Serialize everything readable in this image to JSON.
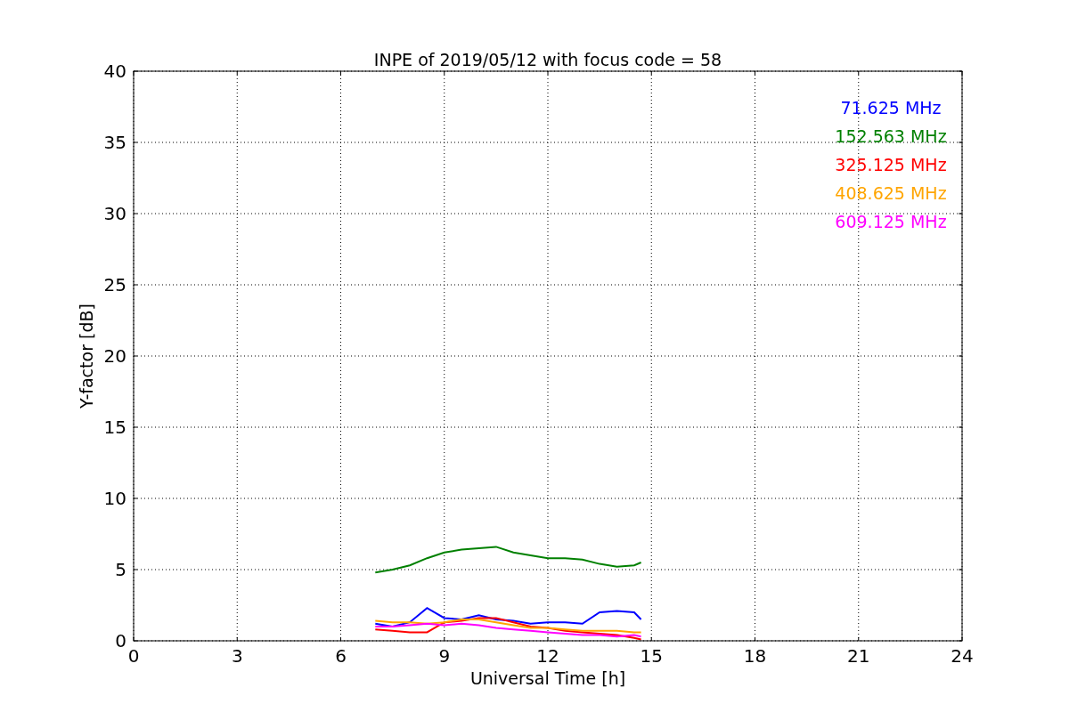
{
  "chart_data": {
    "type": "line",
    "title": "INPE of 2019/05/12 with focus code = 58",
    "xlabel": "Universal Time [h]",
    "ylabel": "Y-factor [dB]",
    "x": [
      7,
      7.5,
      8,
      8.5,
      9,
      9.5,
      10,
      10.5,
      11,
      11.5,
      12,
      12.5,
      13,
      13.5,
      14,
      14.5,
      14.7
    ],
    "series": [
      {
        "name": "71.625 MHz",
        "color": "#0000ff",
        "values": [
          1.2,
          1.0,
          1.3,
          2.3,
          1.6,
          1.5,
          1.8,
          1.5,
          1.4,
          1.2,
          1.3,
          1.3,
          1.2,
          2.0,
          2.1,
          2.0,
          1.5
        ]
      },
      {
        "name": "152.563 MHz",
        "color": "#008000",
        "values": [
          4.8,
          5.0,
          5.3,
          5.8,
          6.2,
          6.4,
          6.5,
          6.6,
          6.2,
          6.0,
          5.8,
          5.8,
          5.7,
          5.4,
          5.2,
          5.3,
          5.5
        ]
      },
      {
        "name": "325.125 MHz",
        "color": "#ff0000",
        "values": [
          0.8,
          0.7,
          0.6,
          0.6,
          1.3,
          1.4,
          1.6,
          1.6,
          1.3,
          1.0,
          0.9,
          0.7,
          0.6,
          0.5,
          0.4,
          0.2,
          0.1
        ]
      },
      {
        "name": "408.625 MHz",
        "color": "#ffa500",
        "values": [
          1.4,
          1.3,
          1.3,
          1.2,
          1.3,
          1.5,
          1.5,
          1.3,
          1.1,
          0.9,
          0.9,
          0.8,
          0.7,
          0.7,
          0.7,
          0.6,
          0.6
        ]
      },
      {
        "name": "609.125 MHz",
        "color": "#ff00ff",
        "values": [
          1.0,
          1.0,
          1.1,
          1.2,
          1.1,
          1.2,
          1.1,
          0.9,
          0.8,
          0.7,
          0.6,
          0.5,
          0.4,
          0.4,
          0.3,
          0.4,
          0.3
        ]
      }
    ],
    "xlim": [
      0,
      24
    ],
    "ylim": [
      0,
      40
    ],
    "xticks": [
      0,
      3,
      6,
      9,
      12,
      15,
      18,
      21,
      24
    ],
    "yticks": [
      0,
      5,
      10,
      15,
      20,
      25,
      30,
      35,
      40
    ],
    "grid": true
  }
}
